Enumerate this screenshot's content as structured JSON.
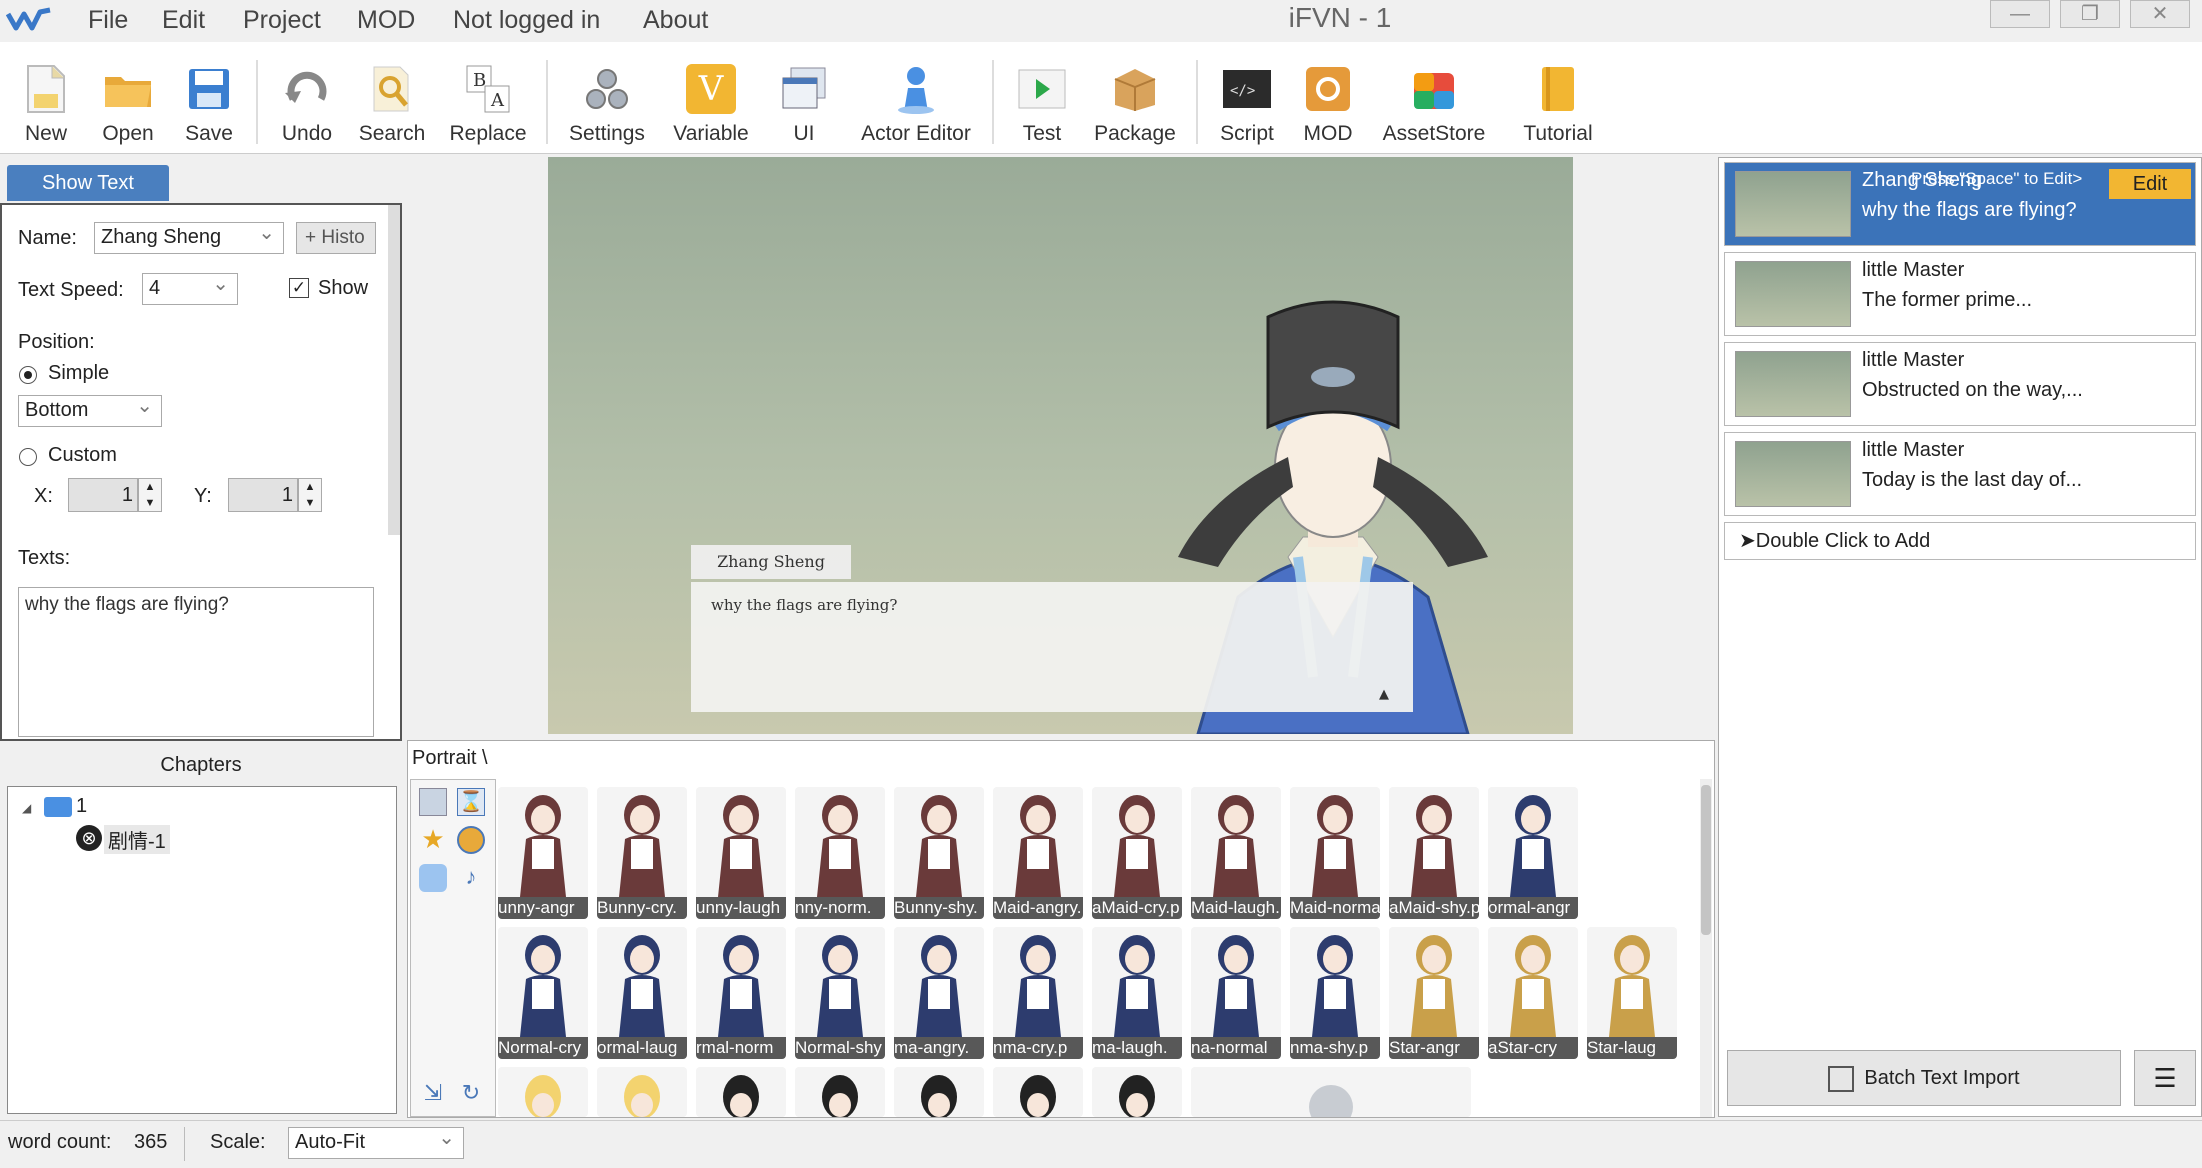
{
  "app": {
    "title": "iFVN - 1"
  },
  "menu": [
    "File",
    "Edit",
    "Project",
    "MOD",
    "Not logged in",
    "About"
  ],
  "toolbar": [
    "New",
    "Open",
    "Save",
    "Undo",
    "Search",
    "Replace",
    "Settings",
    "Variable",
    "UI",
    "Actor Editor",
    "Test",
    "Package",
    "Script",
    "MOD",
    "AssetStore",
    "Tutorial"
  ],
  "props": {
    "tab": "Show Text",
    "name_label": "Name:",
    "name_value": "Zhang Sheng",
    "history_button": "+ Histo",
    "speed_label": "Text Speed:",
    "speed_value": "4",
    "show_label": "Show",
    "position_label": "Position:",
    "simple_label": "Simple",
    "bottom_value": "Bottom",
    "custom_label": "Custom",
    "x_label": "X:",
    "x_value": "1",
    "y_label": "Y:",
    "y_value": "1",
    "texts_label": "Texts:",
    "texts_value": "why the flags are flying?"
  },
  "stage": {
    "speaker": "Zhang Sheng",
    "dialog": "why the flags are flying?",
    "arrow": "▲"
  },
  "events": [
    {
      "name": "Zhang Sheng",
      "text": "why the flags are flying?",
      "selected": true,
      "hint": "Press \"Space\" to Edit>",
      "edit": "Edit"
    },
    {
      "name": "little Master",
      "text": "The former prime..."
    },
    {
      "name": "little Master",
      "text": "Obstructed on the way,..."
    },
    {
      "name": "little Master",
      "text": "Today is the last day of..."
    }
  ],
  "add_hint": "➤Double Click to Add",
  "batch_button": "Batch Text Import",
  "chapters": {
    "title": "Chapters",
    "root": "1",
    "child": "剧情-1"
  },
  "portrait": {
    "path": "Portrait \\",
    "row1": [
      "unny-angr",
      "Bunny-cry.",
      "unny-laugh",
      "nny-norm.",
      "Bunny-shy.",
      "Maid-angry.",
      "aMaid-cry.p",
      "Maid-laugh.",
      "Maid-normal",
      "aMaid-shy.p",
      "ormal-angr"
    ],
    "row2": [
      "Normal-cry",
      "ormal-laug",
      "rmal-norm",
      "Normal-shy",
      "ma-angry.",
      "nma-cry.p",
      "ma-laugh.",
      "na-normal",
      "nma-shy.p",
      "Star-angr",
      "aStar-cry",
      "Star-laug"
    ]
  },
  "status": {
    "word_count_label": "word count:",
    "word_count": "365",
    "scale_label": "Scale:",
    "scale_value": "Auto-Fit"
  }
}
